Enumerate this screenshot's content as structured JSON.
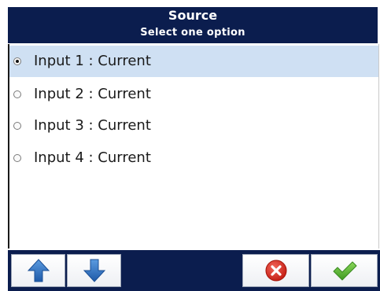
{
  "header": {
    "title": "Source",
    "subtitle": "Select one option"
  },
  "options": [
    {
      "label": "Input 1 : Current",
      "selected": true
    },
    {
      "label": "Input 2 : Current",
      "selected": false
    },
    {
      "label": "Input 3 : Current",
      "selected": false
    },
    {
      "label": "Input 4 : Current",
      "selected": false
    }
  ],
  "toolbar": {
    "buttons": [
      {
        "name": "scroll-up",
        "icon": "arrow-up-icon"
      },
      {
        "name": "scroll-down",
        "icon": "arrow-down-icon"
      },
      {
        "name": "cancel",
        "icon": "cancel-x-icon"
      },
      {
        "name": "confirm",
        "icon": "checkmark-icon"
      }
    ]
  },
  "colors": {
    "header_bg": "#0b1d4e",
    "selected_row": "#cfe0f3",
    "arrow_blue": "#2e6fc0",
    "cancel_red": "#d9261c",
    "confirm_green": "#5cb531"
  }
}
